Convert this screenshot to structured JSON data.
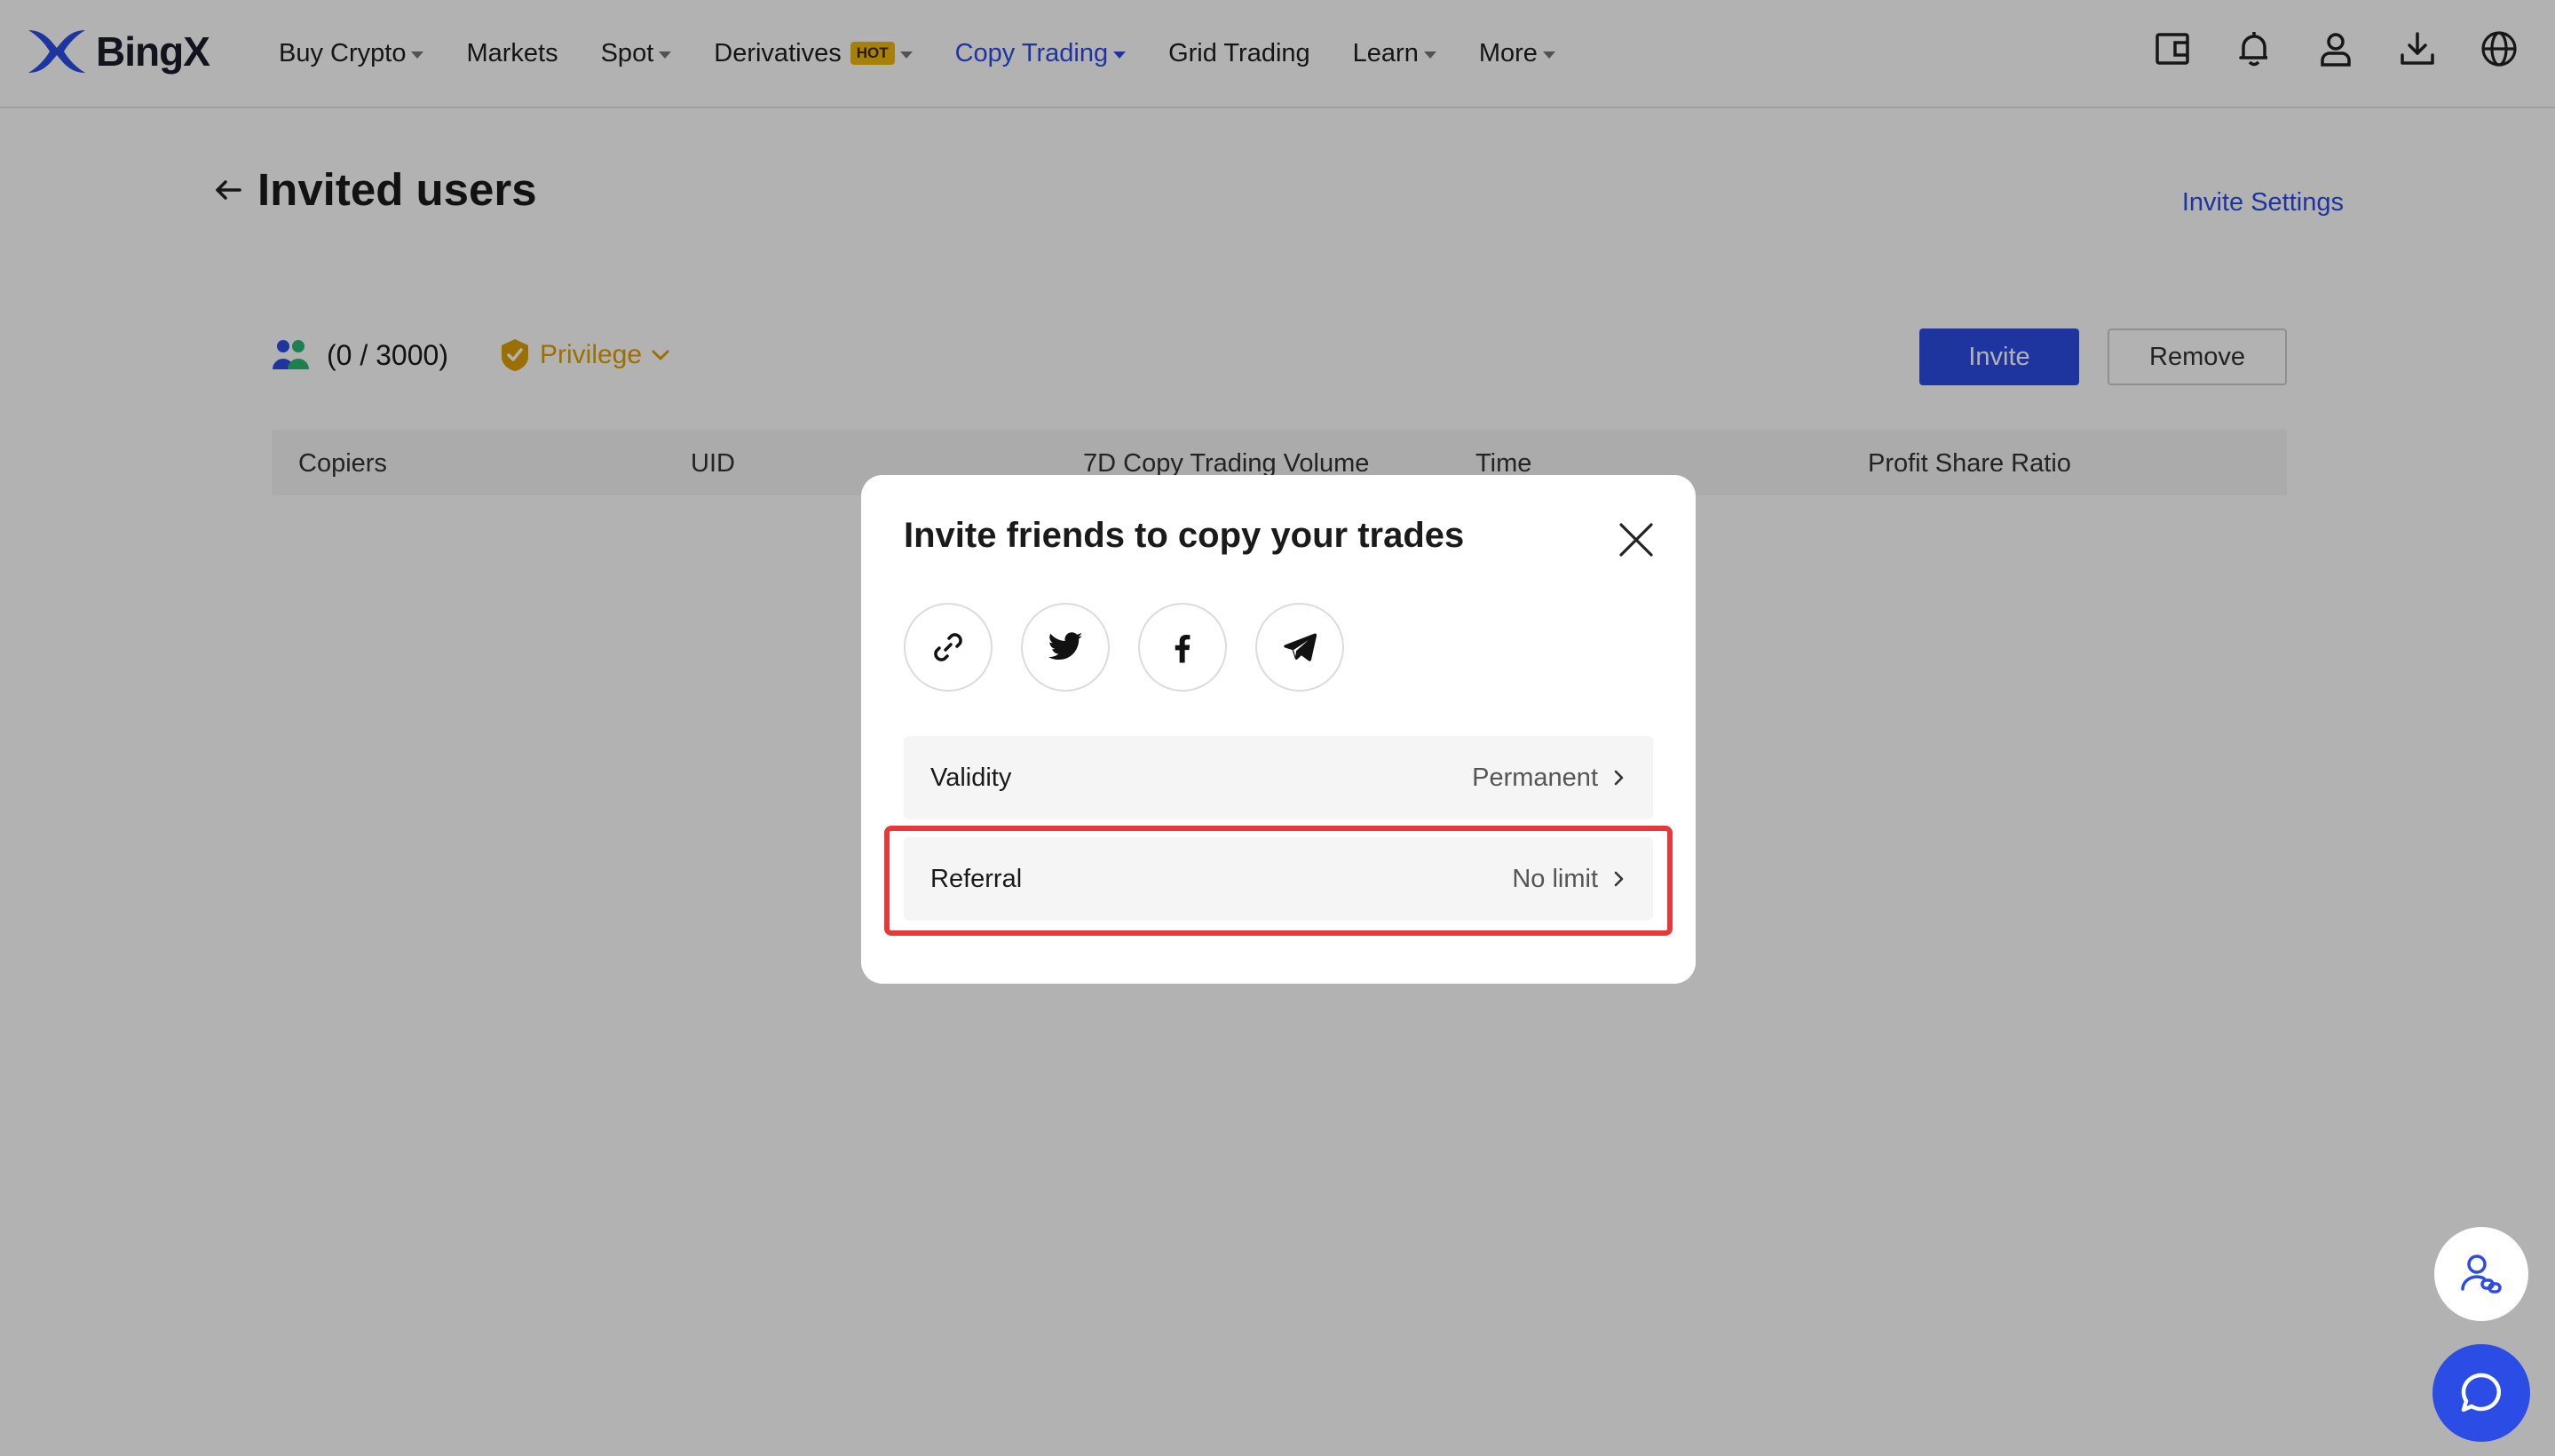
{
  "header": {
    "logo_text": "BingX",
    "nav": [
      {
        "label": "Buy Crypto",
        "dropdown": true
      },
      {
        "label": "Markets",
        "dropdown": false
      },
      {
        "label": "Spot",
        "dropdown": true
      },
      {
        "label": "Derivatives",
        "dropdown": true,
        "badge": "HOT"
      },
      {
        "label": "Copy Trading",
        "dropdown": true,
        "active": true
      },
      {
        "label": "Grid Trading",
        "dropdown": false
      },
      {
        "label": "Learn",
        "dropdown": true
      },
      {
        "label": "More",
        "dropdown": true
      }
    ],
    "icons": [
      "wallet-icon",
      "bell-icon",
      "user-icon",
      "download-icon",
      "globe-icon"
    ]
  },
  "page": {
    "title": "Invited users",
    "invite_settings": "Invite Settings"
  },
  "card": {
    "count": "(0 / 3000)",
    "privilege": "Privilege",
    "invite_button": "Invite",
    "remove_button": "Remove",
    "columns": [
      "Copiers",
      "UID",
      "7D Copy Trading Volume",
      "Time",
      "Profit Share Ratio"
    ]
  },
  "modal": {
    "title": "Invite friends to copy your trades",
    "share_icons": [
      "link-icon",
      "twitter-icon",
      "facebook-icon",
      "telegram-icon"
    ],
    "options": {
      "validity": {
        "label": "Validity",
        "value": "Permanent"
      },
      "referral": {
        "label": "Referral",
        "value": "No limit"
      }
    }
  },
  "colors": {
    "accent": "#2b4de6",
    "privilege": "#e0a100",
    "highlight": "#e53a3a",
    "hot_badge": "#f0b90b"
  }
}
